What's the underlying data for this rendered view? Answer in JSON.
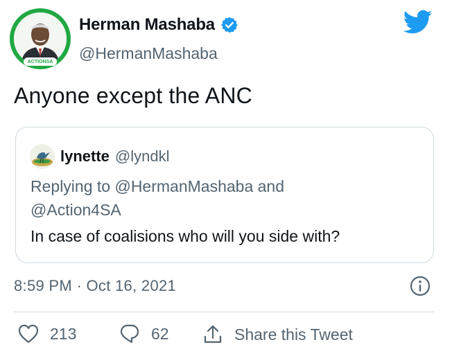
{
  "author": {
    "display_name": "Herman Mashaba",
    "handle": "@HermanMashaba",
    "verified_icon": "verified-badge-icon",
    "avatar_label": "ACTIONSA"
  },
  "brand_icon": "twitter-bird-icon",
  "tweet": {
    "text": "Anyone except the ANC"
  },
  "quoted": {
    "name": "lynette",
    "handle": "@lyndkl",
    "reply_prefix": "Replying to ",
    "reply_to_1": "@HermanMashaba",
    "reply_and": " and",
    "reply_to_2": "@Action4SA",
    "text": "In case of coalisions who will you side with?"
  },
  "meta": {
    "timestamp": "8:59 PM · Oct 16, 2021",
    "info_icon": "info-icon"
  },
  "actions": {
    "likes": "213",
    "replies": "62",
    "share_label": "Share this Tweet"
  },
  "colors": {
    "accent_blue": "#1d9bf0",
    "brand_green": "#21a842",
    "muted_text": "#536471",
    "primary_text": "#0f1419",
    "border": "#cfd9de"
  }
}
